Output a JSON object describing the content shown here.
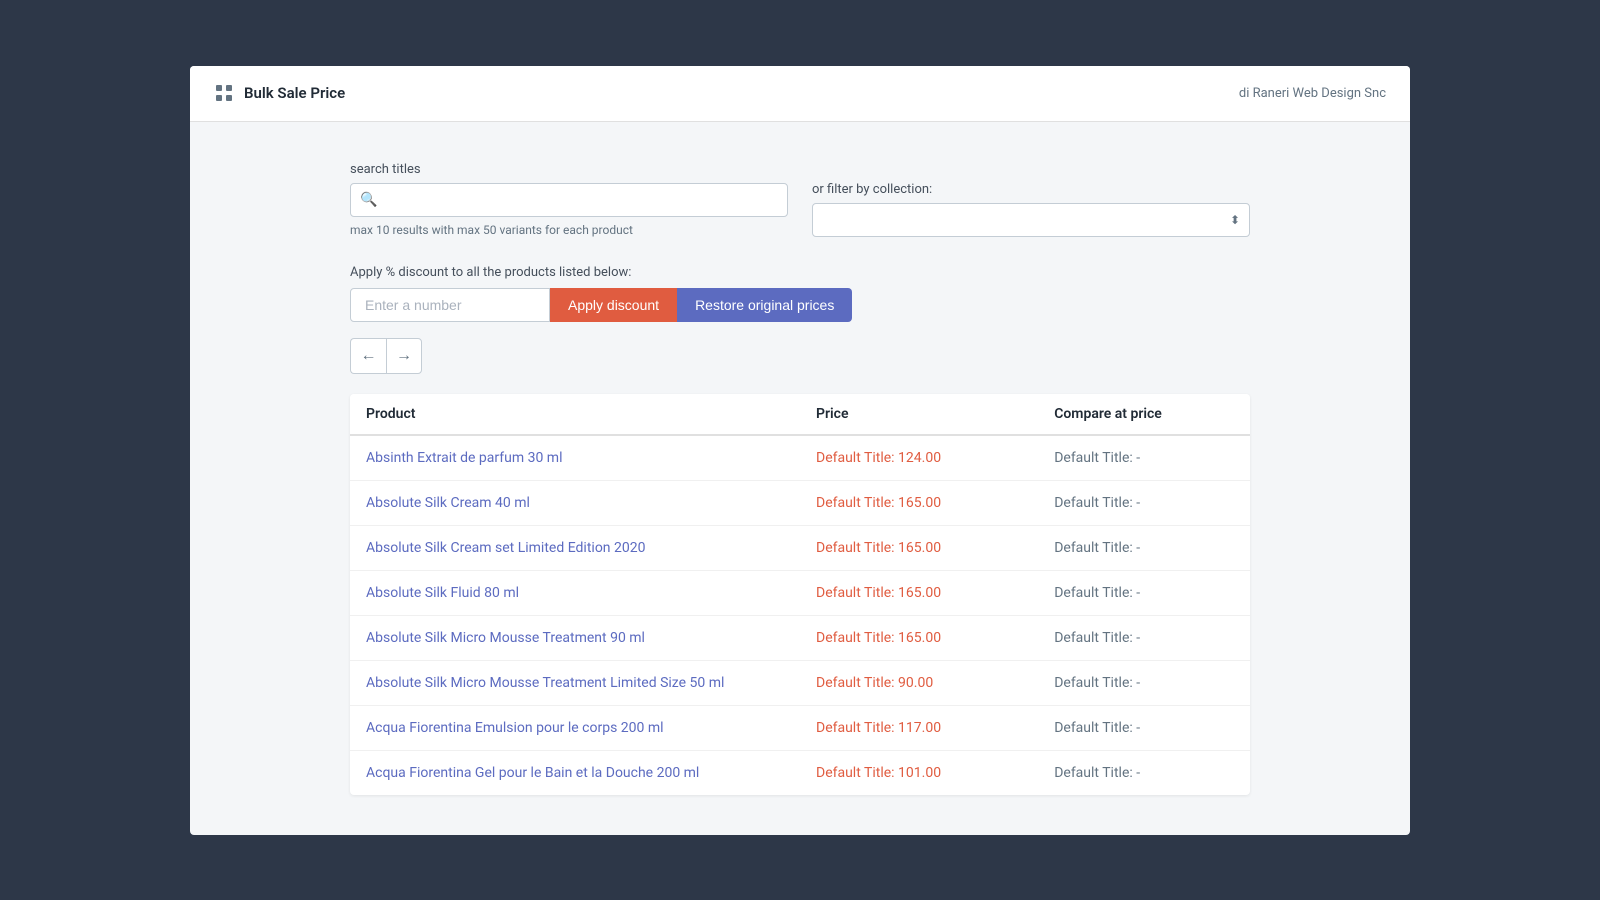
{
  "header": {
    "app_title": "Bulk Sale Price",
    "subtitle": "di Raneri Web Design Snc",
    "icon": "grid-icon"
  },
  "search": {
    "label": "search titles",
    "placeholder": "",
    "hint": "max 10 results with max 50 variants for each product"
  },
  "filter": {
    "label": "or filter by collection:"
  },
  "discount": {
    "label": "Apply % discount to all the products listed below:",
    "input_placeholder": "Enter a number",
    "apply_btn": "Apply discount",
    "restore_btn": "Restore original prices"
  },
  "navigation": {
    "prev": "←",
    "next": "→"
  },
  "table": {
    "columns": [
      "Product",
      "Price",
      "Compare at price"
    ],
    "rows": [
      {
        "product": "Absinth Extrait de parfum 30 ml",
        "price": "Default Title: 124.00",
        "compare": "Default Title: -"
      },
      {
        "product": "Absolute Silk Cream 40 ml",
        "price": "Default Title: 165.00",
        "compare": "Default Title: -"
      },
      {
        "product": "Absolute Silk Cream set Limited Edition 2020",
        "price": "Default Title: 165.00",
        "compare": "Default Title: -"
      },
      {
        "product": "Absolute Silk Fluid 80 ml",
        "price": "Default Title: 165.00",
        "compare": "Default Title: -"
      },
      {
        "product": "Absolute Silk Micro Mousse Treatment 90 ml",
        "price": "Default Title: 165.00",
        "compare": "Default Title: -"
      },
      {
        "product": "Absolute Silk Micro Mousse Treatment Limited Size 50 ml",
        "price": "Default Title: 90.00",
        "compare": "Default Title: -"
      },
      {
        "product": "Acqua Fiorentina Emulsion pour le corps 200 ml",
        "price": "Default Title: 117.00",
        "compare": "Default Title: -"
      },
      {
        "product": "Acqua Fiorentina Gel pour le Bain et la Douche 200 ml",
        "price": "Default Title: 101.00",
        "compare": "Default Title: -"
      }
    ]
  }
}
